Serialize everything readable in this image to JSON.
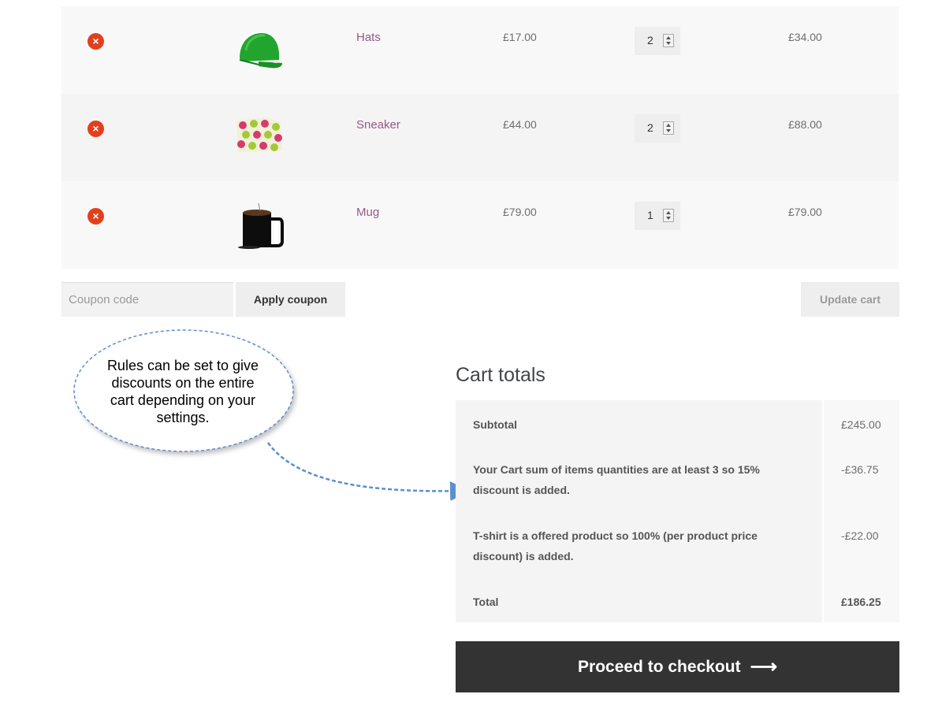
{
  "cart": {
    "items": [
      {
        "name": "Hats",
        "price": "£17.00",
        "quantity": "2",
        "subtotal": "£34.00",
        "thumb_icon": "green-cap-icon"
      },
      {
        "name": "Sneaker",
        "price": "£44.00",
        "quantity": "2",
        "subtotal": "£88.00",
        "thumb_icon": "patterned-fabric-icon"
      },
      {
        "name": "Mug",
        "price": "£79.00",
        "quantity": "1",
        "subtotal": "£79.00",
        "thumb_icon": "black-mug-icon"
      }
    ],
    "remove_icon": "×"
  },
  "actions": {
    "coupon_placeholder": "Coupon code",
    "apply_coupon_label": "Apply coupon",
    "update_cart_label": "Update cart"
  },
  "callout": {
    "text": "Rules can be set to give discounts on the entire cart depending on your settings."
  },
  "totals": {
    "title": "Cart totals",
    "subtotal_label": "Subtotal",
    "subtotal_value": "£245.00",
    "discount1_label": "Your Cart sum of items quantities are at least 3 so 15% discount is added.",
    "discount1_value": "-£36.75",
    "discount2_label": "T-shirt is a offered product so 100% (per product price discount) is added.",
    "discount2_value": "-£22.00",
    "total_label": "Total",
    "total_value": "£186.25"
  },
  "checkout": {
    "label": "Proceed to checkout",
    "arrow": "⟶"
  },
  "colors": {
    "accent_link": "#96588a",
    "remove_red": "#e2401c",
    "checkout_bg": "#333333",
    "callout_border": "#5b8fd1"
  }
}
